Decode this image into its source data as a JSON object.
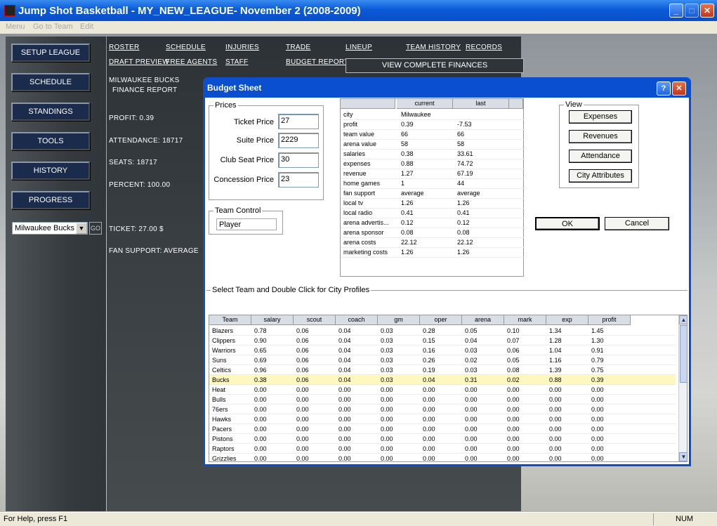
{
  "window": {
    "title": "Jump Shot Basketball - MY_NEW_LEAGUE- November 2 (2008-2009)"
  },
  "menu": [
    "Menu",
    "Go to Team",
    "Edit"
  ],
  "sidebar": {
    "buttons": [
      "SETUP LEAGUE",
      "SCHEDULE",
      "STANDINGS",
      "TOOLS",
      "HISTORY",
      "PROGRESS"
    ],
    "team_select": "Milwaukee Bucks",
    "go_label": "GO"
  },
  "top_links": {
    "roster": "ROSTER",
    "schedule": "SCHEDULE",
    "injuries": "INJURIES",
    "trade": "TRADE",
    "lineup": "LINEUP",
    "team_history": "TEAM HISTORY",
    "records": "RECORDS",
    "draft_preview": "DRAFT PREVIEW",
    "free_agents": "FREE AGENTS",
    "staff": "STAFF",
    "budget_report": "BUDGET REPORT",
    "view_complete_finances": "VIEW COMPLETE FINANCES"
  },
  "finance_report": {
    "team": "MILWAUKEE BUCKS",
    "heading": "FINANCE REPORT",
    "profit": "PROFIT: 0.39",
    "attendance": "ATTENDANCE: 18717",
    "seats": "SEATS: 18717",
    "percent": "PERCENT: 100.00",
    "ticket": "TICKET: 27.00 $",
    "fan_support": "FAN SUPPORT: AVERAGE"
  },
  "dialog": {
    "title": "Budget Sheet",
    "help_label": "?",
    "close_label": "✕",
    "prices": {
      "legend": "Prices",
      "ticket_label": "Ticket Price",
      "ticket_value": "27",
      "suite_label": "Suite Price",
      "suite_value": "2229",
      "club_label": "Club Seat Price",
      "club_value": "30",
      "concession_label": "Concession Price",
      "concession_value": "23"
    },
    "team_control": {
      "legend": "Team Control",
      "value": "Player"
    },
    "view": {
      "legend": "View",
      "buttons": [
        "Expenses",
        "Revenues",
        "Attendance",
        "City Attributes"
      ]
    },
    "ok_label": "OK",
    "cancel_label": "Cancel",
    "finance_grid": {
      "headers": [
        "current",
        "last"
      ],
      "rows": [
        [
          "city",
          "Milwaukee",
          ""
        ],
        [
          "profit",
          "0.39",
          "-7.53"
        ],
        [
          "team value",
          "66",
          "66"
        ],
        [
          "arena value",
          "58",
          "58"
        ],
        [
          "salaries",
          "0.38",
          "33.61"
        ],
        [
          "expenses",
          "0.88",
          "74.72"
        ],
        [
          "revenue",
          "1.27",
          "67.19"
        ],
        [
          "home games",
          "1",
          "44"
        ],
        [
          "fan support",
          "average",
          "average"
        ],
        [
          "local tv",
          "1.26",
          "1.26"
        ],
        [
          "local radio",
          "0.41",
          "0.41"
        ],
        [
          "arena advertis...",
          "0.12",
          "0.12"
        ],
        [
          "arena sponsor",
          "0.08",
          "0.08"
        ],
        [
          "arena costs",
          "22.12",
          "22.12"
        ],
        [
          "marketing costs",
          "1.26",
          "1.26"
        ]
      ]
    },
    "team_grid_legend": "Select Team and Double Click for City Profiles",
    "team_grid": {
      "headers": [
        "Team",
        "salary",
        "scout",
        "coach",
        "gm",
        "oper",
        "arena",
        "mark",
        "exp",
        "profit"
      ],
      "rows": [
        [
          "Blazers",
          "0.78",
          "0.06",
          "0.04",
          "0.03",
          "0.28",
          "0.05",
          "0.10",
          "1.34",
          "1.45"
        ],
        [
          "Clippers",
          "0.90",
          "0.06",
          "0.04",
          "0.03",
          "0.15",
          "0.04",
          "0.07",
          "1.28",
          "1.30"
        ],
        [
          "Warriors",
          "0.65",
          "0.06",
          "0.04",
          "0.03",
          "0.16",
          "0.03",
          "0.06",
          "1.04",
          "0.91"
        ],
        [
          "Suns",
          "0.69",
          "0.06",
          "0.04",
          "0.03",
          "0.26",
          "0.02",
          "0.05",
          "1.16",
          "0.79"
        ],
        [
          "Celtics",
          "0.96",
          "0.06",
          "0.04",
          "0.03",
          "0.19",
          "0.03",
          "0.08",
          "1.39",
          "0.75"
        ],
        [
          "Bucks",
          "0.38",
          "0.06",
          "0.04",
          "0.03",
          "0.04",
          "0.31",
          "0.02",
          "0.88",
          "0.39"
        ],
        [
          "Heat",
          "0.00",
          "0.00",
          "0.00",
          "0.00",
          "0.00",
          "0.00",
          "0.00",
          "0.00",
          "0.00"
        ],
        [
          "Bulls",
          "0.00",
          "0.00",
          "0.00",
          "0.00",
          "0.00",
          "0.00",
          "0.00",
          "0.00",
          "0.00"
        ],
        [
          "76ers",
          "0.00",
          "0.00",
          "0.00",
          "0.00",
          "0.00",
          "0.00",
          "0.00",
          "0.00",
          "0.00"
        ],
        [
          "Hawks",
          "0.00",
          "0.00",
          "0.00",
          "0.00",
          "0.00",
          "0.00",
          "0.00",
          "0.00",
          "0.00"
        ],
        [
          "Pacers",
          "0.00",
          "0.00",
          "0.00",
          "0.00",
          "0.00",
          "0.00",
          "0.00",
          "0.00",
          "0.00"
        ],
        [
          "Pistons",
          "0.00",
          "0.00",
          "0.00",
          "0.00",
          "0.00",
          "0.00",
          "0.00",
          "0.00",
          "0.00"
        ],
        [
          "Raptors",
          "0.00",
          "0.00",
          "0.00",
          "0.00",
          "0.00",
          "0.00",
          "0.00",
          "0.00",
          "0.00"
        ],
        [
          "Grizzlies",
          "0.00",
          "0.00",
          "0.00",
          "0.00",
          "0.00",
          "0.00",
          "0.00",
          "0.00",
          "0.00"
        ]
      ],
      "selected_team": "Bucks"
    }
  },
  "statusbar": {
    "help": "For Help, press F1",
    "num": "NUM"
  },
  "colors": {
    "title_blue": "#0a4fcf",
    "selected_row": "#fff7c0",
    "nav_button": "#1b2b4c"
  }
}
